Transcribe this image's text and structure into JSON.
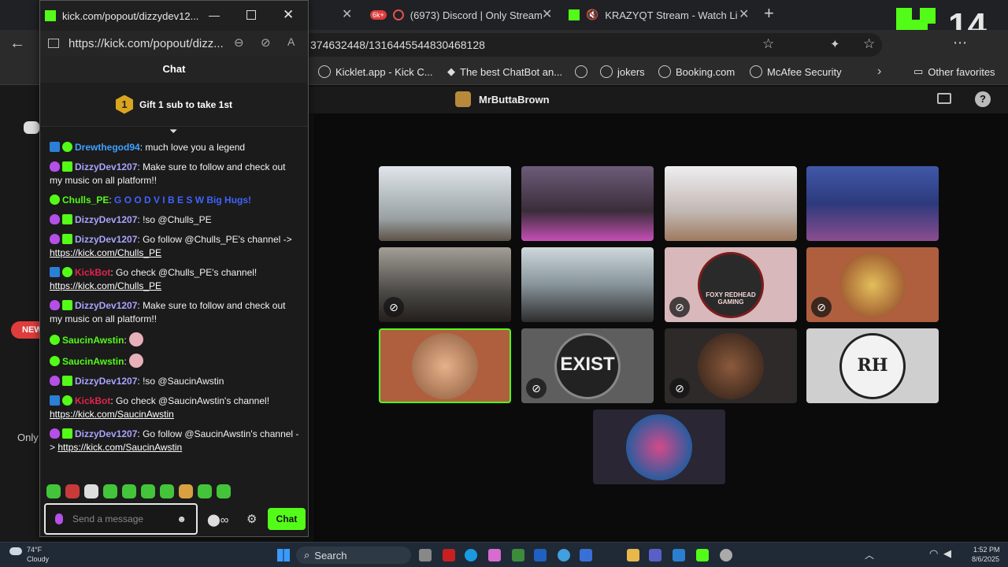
{
  "browser": {
    "tabs": [
      {
        "title": "(6973) Discord | Only Stream"
      },
      {
        "title": "KRAZYQT Stream - Watch Li"
      }
    ],
    "discord_badge": "6k+",
    "url": "374632448/1316445544830468128",
    "favorites": [
      "Kicklet.app - Kick C...",
      "The best ChatBot an...",
      "jokers",
      "Booking.com",
      "McAfee Security"
    ],
    "other_favorites": "Other favorites"
  },
  "popup": {
    "title": "kick.com/popout/dizzydev12...",
    "url": "https://kick.com/popout/dizz...",
    "chat_header": "Chat",
    "gift_text": "Gift 1 sub to take 1st",
    "gift_rank": "1"
  },
  "chat": {
    "messages": [
      {
        "user": "Drewthegod94",
        "text": "much love you a legend"
      },
      {
        "user": "DizzyDev1207",
        "text": "Make sure to follow and check out my music on all platform!!"
      },
      {
        "user": "Chulls_PE",
        "text": "G O O D V I B E S W Big Hugs!"
      },
      {
        "user": "DizzyDev1207",
        "text": "!so @Chulls_PE"
      },
      {
        "user": "DizzyDev1207",
        "text": "Go follow @Chulls_PE's channel ->",
        "link": "https://kick.com/Chulls_PE"
      },
      {
        "user": "KickBot",
        "text": "Go check @Chulls_PE's channel!",
        "link": "https://kick.com/Chulls_PE"
      },
      {
        "user": "DizzyDev1207",
        "text": "Make sure to follow and check out my music on all platform!!"
      },
      {
        "user": "SaucinAwstin",
        "text": ""
      },
      {
        "user": "SaucinAwstin",
        "text": ""
      },
      {
        "user": "DizzyDev1207",
        "text": "!so @SaucinAwstin"
      },
      {
        "user": "KickBot",
        "text": "Go check @SaucinAwstin's channel!",
        "link": "https://kick.com/SaucinAwstin"
      },
      {
        "user": "DizzyDev1207",
        "text": "Go follow @SaucinAwstin's channel - >",
        "link": "https://kick.com/SaucinAwstin"
      }
    ],
    "input_placeholder": "Send a message",
    "send_label": "Chat"
  },
  "stage": {
    "host": "MrButtaBrown",
    "tiles": [
      {
        "label": "",
        "muted": false
      },
      {
        "label": "",
        "muted": false
      },
      {
        "label": "",
        "muted": false
      },
      {
        "label": "",
        "muted": false
      },
      {
        "label": "",
        "muted": true
      },
      {
        "label": "",
        "muted": false
      },
      {
        "label": "FOXY REDHEAD GAMING",
        "muted": true
      },
      {
        "label": "",
        "muted": false
      },
      {
        "label": "",
        "muted": false
      },
      {
        "label": "EXIST",
        "muted": true
      },
      {
        "label": "",
        "muted": true
      },
      {
        "label": "RH",
        "muted": false
      },
      {
        "label": "",
        "muted": false
      }
    ]
  },
  "overlay": {
    "counter": "14"
  },
  "sidebar": {
    "new_label": "NEW",
    "only_label": "Only"
  },
  "taskbar": {
    "weather_temp": "74°F",
    "weather_desc": "Cloudy",
    "search_label": "Search",
    "time": "1:52 PM",
    "date": "8/6/2025"
  },
  "colors": {
    "kick_green": "#53fc18",
    "bot_red": "#e0244f",
    "user_blue": "#3fa2ff"
  }
}
